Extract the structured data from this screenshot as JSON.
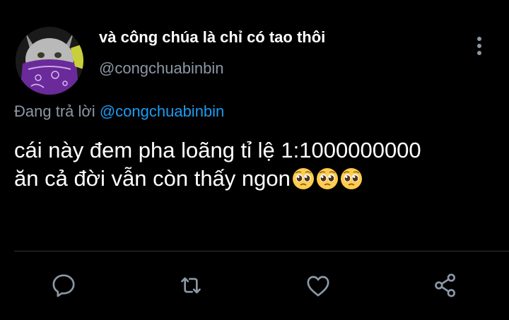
{
  "tweet": {
    "display_name": "và công chúa là chỉ có tao thôi",
    "handle": "@congchuabinbin",
    "reply_prefix": "Đang trả lời",
    "reply_to": "@congchuabinbin",
    "text_line1": "cái này đem pha loãng tỉ lệ 1:1000000000",
    "text_line2": "ăn cả đời vẫn còn thấy ngon",
    "emojis": [
      "pleading-face",
      "pleading-face",
      "pleading-face"
    ]
  },
  "actions": {
    "icons": [
      "reply-icon",
      "retweet-icon",
      "like-icon",
      "share-icon"
    ]
  },
  "colors": {
    "background": "#000000",
    "text": "#ffffff",
    "secondary": "#8b98a5",
    "link": "#1d9bf0",
    "divider": "#2f3336"
  }
}
